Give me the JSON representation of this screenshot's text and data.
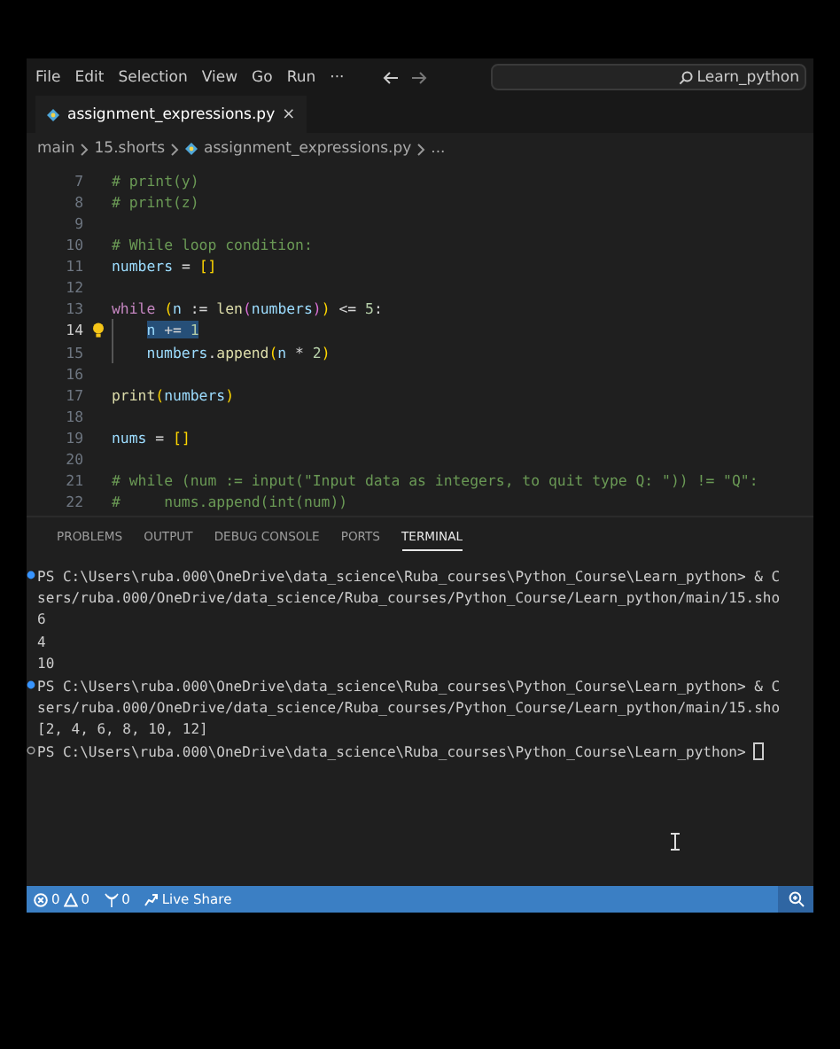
{
  "menu_bar": {
    "items": [
      "File",
      "Edit",
      "Selection",
      "View",
      "Go",
      "Run",
      "···"
    ],
    "search": {
      "value": "Learn_python"
    }
  },
  "tabs": [
    {
      "label": "assignment_expressions.py",
      "close": "×",
      "selected": true
    }
  ],
  "breadcrumbs": [
    {
      "label": "main",
      "kind": "folder"
    },
    {
      "label": "15.shorts",
      "kind": "folder"
    },
    {
      "label": "assignment_expressions.py",
      "kind": "file"
    },
    {
      "label": "...",
      "kind": "more"
    }
  ],
  "editor": {
    "lines": [
      {
        "number": "7",
        "tokens": [
          {
            "text": "# print(y)",
            "kind": "comment"
          }
        ]
      },
      {
        "number": "8",
        "tokens": [
          {
            "text": "# print(z)",
            "kind": "comment"
          }
        ]
      },
      {
        "number": "9"
      },
      {
        "number": "10",
        "tokens": [
          {
            "text": "# While loop condition:",
            "kind": "comment"
          }
        ]
      },
      {
        "number": "11",
        "tokens": [
          {
            "text": "numbers",
            "kind": "variable"
          },
          {
            "text": " = ",
            "kind": "plain"
          },
          {
            "text": "[]",
            "kind": "bracket"
          }
        ]
      },
      {
        "number": "12"
      },
      {
        "number": "13",
        "tokens": [
          {
            "text": "while",
            "kind": "keyword"
          },
          {
            "text": " (",
            "kind": "bracket"
          },
          {
            "text": "n",
            "kind": "variable"
          },
          {
            "text": " := ",
            "kind": "plain"
          },
          {
            "text": "len",
            "kind": "function"
          },
          {
            "text": "(",
            "kind": "bracket2"
          },
          {
            "text": "numbers",
            "kind": "variable"
          },
          {
            "text": ")",
            "kind": "bracket2"
          },
          {
            "text": ")",
            "kind": "bracket"
          },
          {
            "text": " <= ",
            "kind": "plain"
          },
          {
            "text": "5",
            "kind": "number"
          },
          {
            "text": ":",
            "kind": "plain"
          }
        ]
      },
      {
        "number": "14",
        "current": true,
        "hint": true,
        "selection": true,
        "indented": true,
        "tokens": [
          {
            "text": "n",
            "kind": "variable"
          },
          {
            "text": " += ",
            "kind": "plain"
          },
          {
            "text": "1",
            "kind": "number"
          }
        ]
      },
      {
        "number": "15",
        "indented": true,
        "tokens": [
          {
            "text": "numbers",
            "kind": "variable"
          },
          {
            "text": ".",
            "kind": "plain"
          },
          {
            "text": "append",
            "kind": "function"
          },
          {
            "text": "(",
            "kind": "bracket"
          },
          {
            "text": "n",
            "kind": "variable"
          },
          {
            "text": " * ",
            "kind": "plain"
          },
          {
            "text": "2",
            "kind": "number"
          },
          {
            "text": ")",
            "kind": "bracket"
          }
        ]
      },
      {
        "number": "16"
      },
      {
        "number": "17",
        "tokens": [
          {
            "text": "print",
            "kind": "function"
          },
          {
            "text": "(",
            "kind": "bracket"
          },
          {
            "text": "numbers",
            "kind": "variable"
          },
          {
            "text": ")",
            "kind": "bracket"
          }
        ]
      },
      {
        "number": "18"
      },
      {
        "number": "19",
        "tokens": [
          {
            "text": "nums",
            "kind": "variable"
          },
          {
            "text": " = ",
            "kind": "plain"
          },
          {
            "text": "[]",
            "kind": "bracket"
          }
        ]
      },
      {
        "number": "20"
      },
      {
        "number": "21",
        "tokens": [
          {
            "text": "# while (num := input(\"Input data as integers, to quit type Q: \")) != \"Q\":",
            "kind": "comment"
          }
        ]
      },
      {
        "number": "22",
        "tokens": [
          {
            "text": "#     nums.append(int(num))",
            "kind": "comment"
          }
        ]
      }
    ]
  },
  "panel_tabs": [
    {
      "label": "PROBLEMS",
      "selected": false
    },
    {
      "label": "OUTPUT",
      "selected": false
    },
    {
      "label": "DEBUG CONSOLE",
      "selected": false
    },
    {
      "label": "PORTS",
      "selected": false
    },
    {
      "label": "TERMINAL",
      "selected": true
    }
  ],
  "terminal": {
    "lines": [
      {
        "text": "PS C:\\Users\\ruba.000\\OneDrive\\data_science\\Ruba_courses\\Python_Course\\Learn_python> & C",
        "kind": "done"
      },
      {
        "text": "sers/ruba.000/OneDrive/data_science/Ruba_courses/Python_Course/Learn_python/main/15.sho",
        "kind": "output"
      },
      {
        "text": "6",
        "kind": "output"
      },
      {
        "text": "4",
        "kind": "output"
      },
      {
        "text": "10",
        "kind": "output"
      },
      {
        "text": "PS C:\\Users\\ruba.000\\OneDrive\\data_science\\Ruba_courses\\Python_Course\\Learn_python> & C",
        "kind": "done"
      },
      {
        "text": "sers/ruba.000/OneDrive/data_science/Ruba_courses/Python_Course/Learn_python/main/15.sho",
        "kind": "output"
      },
      {
        "text": "[2, 4, 6, 8, 10, 12]",
        "kind": "output"
      },
      {
        "text": "PS C:\\Users\\ruba.000\\OneDrive\\data_science\\Ruba_courses\\Python_Course\\Learn_python>",
        "kind": "idle"
      }
    ]
  },
  "status_bar": {
    "errors": "0",
    "warnings": "0",
    "ports": "0",
    "live_share": "Live Share"
  }
}
